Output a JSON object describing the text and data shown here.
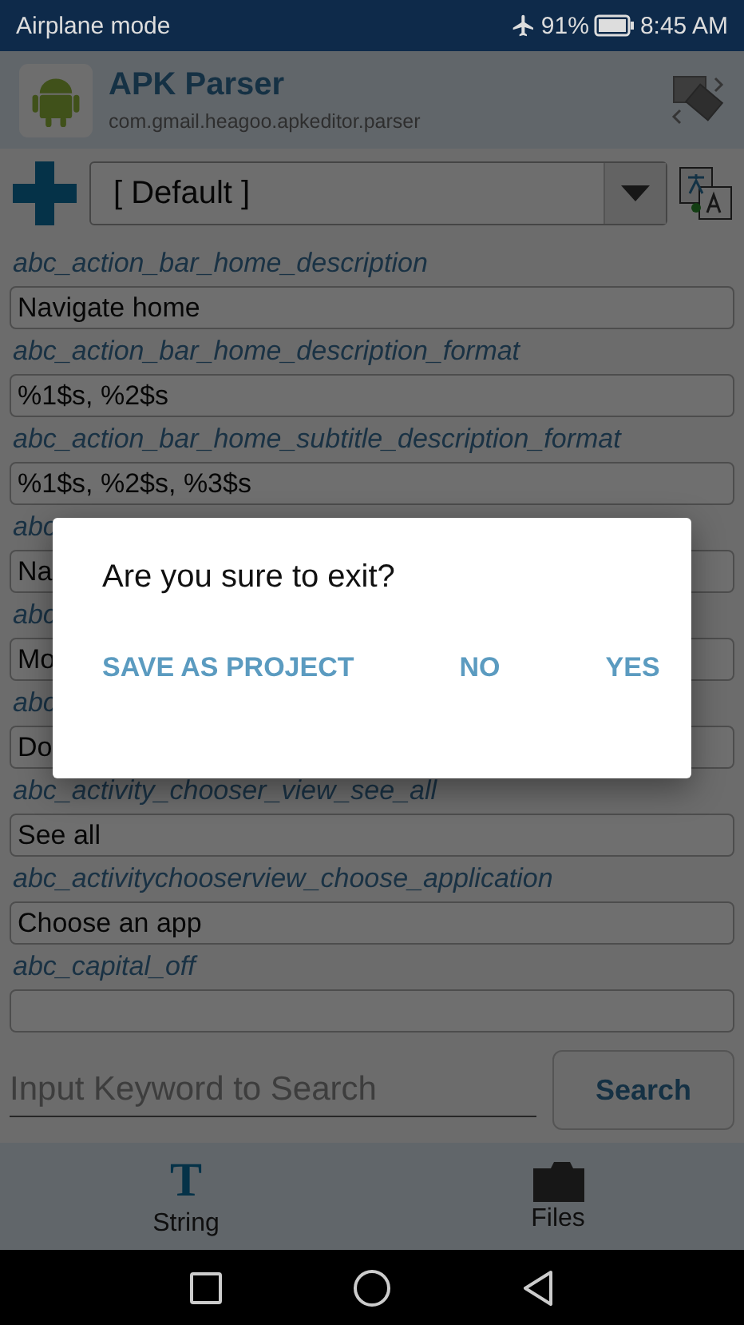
{
  "status_bar": {
    "mode": "Airplane mode",
    "battery": "91%",
    "time": "8:45 AM"
  },
  "app": {
    "title": "APK Parser",
    "package": "com.gmail.heagoo.apkeditor.parser"
  },
  "toolbar": {
    "language": "[ Default ]"
  },
  "strings": [
    {
      "key": "abc_action_bar_home_description",
      "value": "Navigate home"
    },
    {
      "key": "abc_action_bar_home_description_format",
      "value": "%1$s, %2$s"
    },
    {
      "key": "abc_action_bar_home_subtitle_description_format",
      "value": "%1$s, %2$s, %3$s"
    },
    {
      "key": "abc",
      "value": "Na"
    },
    {
      "key": "abc",
      "value": "Mo"
    },
    {
      "key": "abc",
      "value": "Do"
    },
    {
      "key": "abc_activity_chooser_view_see_all",
      "value": "See all"
    },
    {
      "key": "abc_activitychooserview_choose_application",
      "value": "Choose an app"
    },
    {
      "key": "abc_capital_off"
    }
  ],
  "search": {
    "placeholder": "Input Keyword to Search",
    "button": "Search"
  },
  "bottom_tabs": [
    {
      "label": "String",
      "icon": "T",
      "selected": true
    },
    {
      "label": "Files",
      "selected": false
    }
  ],
  "dialog": {
    "message": "Are you sure to exit?",
    "buttons": [
      "SAVE AS PROJECT",
      "NO",
      "YES"
    ]
  }
}
